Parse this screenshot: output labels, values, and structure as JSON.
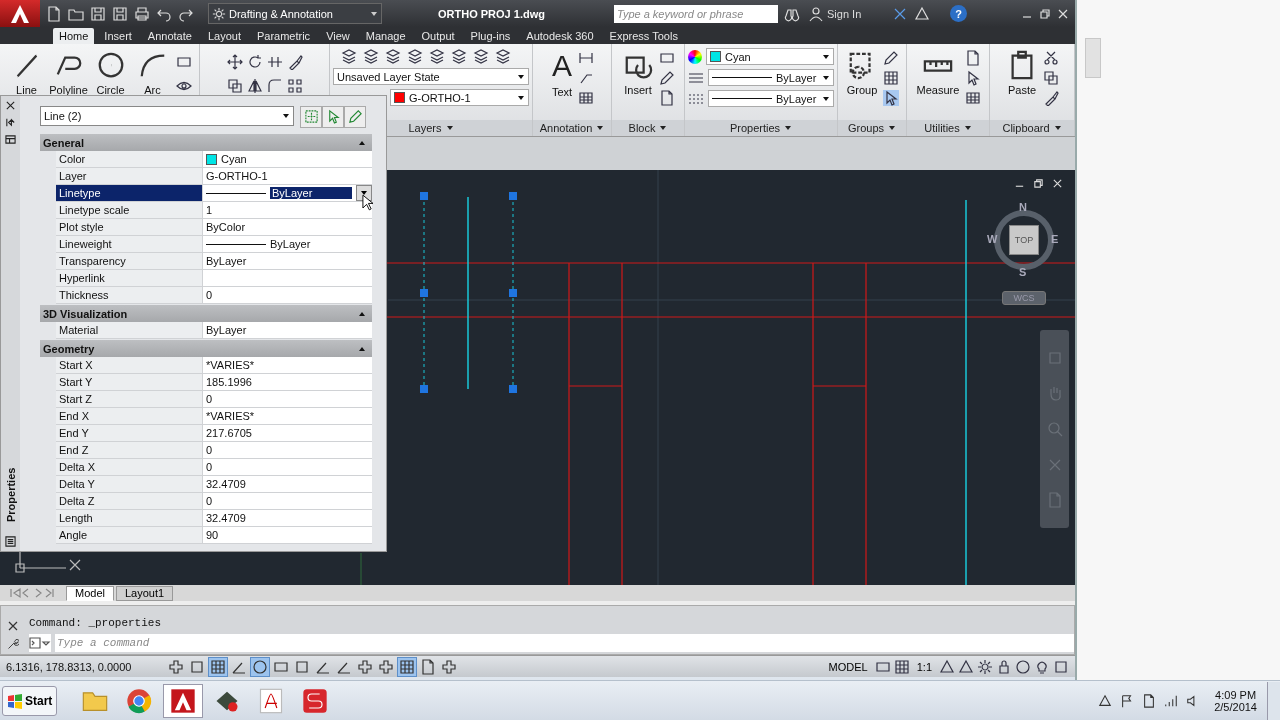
{
  "title_bar": {
    "workspace": "Drafting & Annotation",
    "document": "ORTHO PROJ 1.dwg",
    "search": {
      "placeholder": "Type a keyword or phrase"
    },
    "sign_in": "Sign In",
    "help": "?"
  },
  "ribbon_tabs": [
    {
      "label": "Home",
      "selected": true
    },
    {
      "label": "Insert",
      "selected": false
    },
    {
      "label": "Annotate",
      "selected": false
    },
    {
      "label": "Layout",
      "selected": false
    },
    {
      "label": "Parametric",
      "selected": false
    },
    {
      "label": "View",
      "selected": false
    },
    {
      "label": "Manage",
      "selected": false
    },
    {
      "label": "Output",
      "selected": false
    },
    {
      "label": "Plug-ins",
      "selected": false
    },
    {
      "label": "Autodesk 360",
      "selected": false
    },
    {
      "label": "Express Tools",
      "selected": false
    }
  ],
  "ribbon_panels": [
    {
      "kind": "draw",
      "tools": [
        "Line",
        "Polyline",
        "Circle",
        "Arc"
      ]
    },
    {
      "kind": "modify"
    },
    {
      "kind": "layers",
      "title": "Layers",
      "layer_state": "Unsaved Layer State",
      "layer": "G-ORTHO-1"
    },
    {
      "kind": "annotation",
      "title": "Annotation",
      "tool": "Text",
      "glyph": "A"
    },
    {
      "kind": "block",
      "title": "Block",
      "tool": "Insert"
    },
    {
      "kind": "properties",
      "title": "Properties",
      "color_setting": "Cyan",
      "linetype": "ByLayer",
      "lineweight": "ByLayer"
    },
    {
      "kind": "groups",
      "title": "Groups",
      "tool": "Group"
    },
    {
      "kind": "utilities",
      "title": "Utilities",
      "tool": "Measure"
    },
    {
      "kind": "clipboard",
      "title": "Clipboard",
      "tool": "Paste"
    }
  ],
  "properties_palette": {
    "title": "Properties",
    "object": "Line (2)",
    "sections": [
      {
        "title": "General",
        "expanded": true,
        "rows": [
          {
            "label": "Color",
            "value": "Cyan",
            "kind": "color",
            "selected": false
          },
          {
            "label": "Layer",
            "value": "G-ORTHO-1",
            "kind": "text",
            "selected": false
          },
          {
            "label": "Linetype",
            "value": "ByLayer",
            "kind": "linetype",
            "selected": true
          },
          {
            "label": "Linetype scale",
            "value": "1",
            "kind": "text",
            "selected": false
          },
          {
            "label": "Plot style",
            "value": "ByColor",
            "kind": "text",
            "selected": false
          },
          {
            "label": "Lineweight",
            "value": "ByLayer",
            "kind": "linetype",
            "selected": false
          },
          {
            "label": "Transparency",
            "value": "ByLayer",
            "kind": "text",
            "selected": false
          },
          {
            "label": "Hyperlink",
            "kind": "text",
            "selected": false
          },
          {
            "label": "Thickness",
            "value": "0",
            "kind": "text",
            "selected": false
          }
        ]
      },
      {
        "title": "3D Visualization",
        "expanded": true,
        "rows": [
          {
            "label": "Material",
            "value": "ByLayer",
            "kind": "text",
            "selected": false
          }
        ]
      },
      {
        "title": "Geometry",
        "expanded": true,
        "rows": [
          {
            "label": "Start X",
            "value": "*VARIES*",
            "kind": "text",
            "selected": false
          },
          {
            "label": "Start Y",
            "value": "185.1996",
            "kind": "text",
            "selected": false
          },
          {
            "label": "Start Z",
            "value": "0",
            "kind": "text",
            "selected": false
          },
          {
            "label": "End X",
            "value": "*VARIES*",
            "kind": "text",
            "selected": false
          },
          {
            "label": "End Y",
            "value": "217.6705",
            "kind": "text",
            "selected": false
          },
          {
            "label": "End Z",
            "value": "0",
            "kind": "text",
            "selected": false
          },
          {
            "label": "Delta X",
            "value": "0",
            "kind": "text",
            "selected": false
          },
          {
            "label": "Delta Y",
            "value": "32.4709",
            "kind": "text",
            "selected": false
          },
          {
            "label": "Delta Z",
            "value": "0",
            "kind": "text",
            "selected": false
          },
          {
            "label": "Length",
            "value": "32.4709",
            "kind": "text",
            "selected": false
          },
          {
            "label": "Angle",
            "value": "90",
            "kind": "text",
            "selected": false
          }
        ]
      }
    ]
  },
  "viewport": {
    "compass": {
      "north": "N",
      "south": "S",
      "east": "E",
      "west": "W",
      "view": "TOP"
    },
    "ucs": "WCS"
  },
  "layout_tabs": [
    {
      "label": "Model",
      "selected": true
    },
    {
      "label": "Layout1",
      "selected": false
    }
  ],
  "command_line": {
    "history": "Command: _properties",
    "placeholder": "Type a command"
  },
  "status_bar": {
    "coordinates": "6.1316, 178.8313, 0.0000",
    "toggles": [
      {
        "on": false
      },
      {
        "on": false
      },
      {
        "on": true
      },
      {
        "on": false
      },
      {
        "on": true
      },
      {
        "on": false
      },
      {
        "on": false
      },
      {
        "on": false
      },
      {
        "on": false
      },
      {
        "on": false
      },
      {
        "on": false
      },
      {
        "on": true
      },
      {
        "on": false
      },
      {
        "on": false
      }
    ],
    "space": "MODEL",
    "annotation_scale": "1:1"
  },
  "taskbar": {
    "start": "Start",
    "apps": [
      {
        "kind": "folder",
        "selected": false
      },
      {
        "kind": "browser",
        "selected": false
      },
      {
        "kind": "cad",
        "selected": true
      },
      {
        "kind": "tool",
        "selected": false
      },
      {
        "kind": "pdf",
        "selected": false
      },
      {
        "kind": "sketch",
        "selected": false
      }
    ],
    "time": "4:09 PM",
    "date": "2/5/2014"
  }
}
